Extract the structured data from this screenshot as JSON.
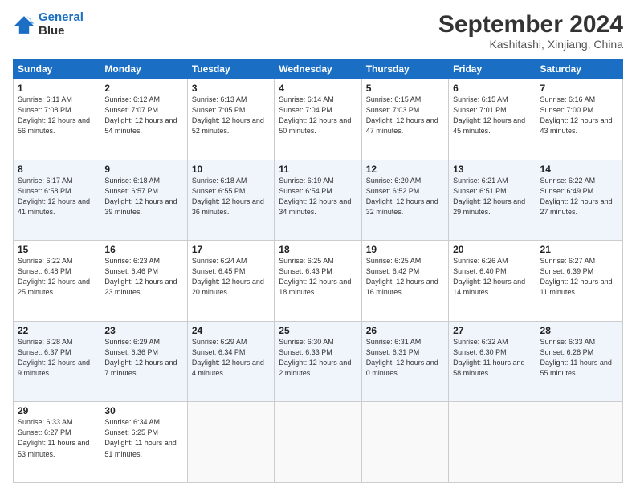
{
  "header": {
    "logo_line1": "General",
    "logo_line2": "Blue",
    "title": "September 2024",
    "subtitle": "Kashitashi, Xinjiang, China"
  },
  "calendar": {
    "days_of_week": [
      "Sunday",
      "Monday",
      "Tuesday",
      "Wednesday",
      "Thursday",
      "Friday",
      "Saturday"
    ],
    "weeks": [
      [
        {
          "day": "1",
          "sunrise": "6:11 AM",
          "sunset": "7:08 PM",
          "daylight": "12 hours and 56 minutes."
        },
        {
          "day": "2",
          "sunrise": "6:12 AM",
          "sunset": "7:07 PM",
          "daylight": "12 hours and 54 minutes."
        },
        {
          "day": "3",
          "sunrise": "6:13 AM",
          "sunset": "7:05 PM",
          "daylight": "12 hours and 52 minutes."
        },
        {
          "day": "4",
          "sunrise": "6:14 AM",
          "sunset": "7:04 PM",
          "daylight": "12 hours and 50 minutes."
        },
        {
          "day": "5",
          "sunrise": "6:15 AM",
          "sunset": "7:03 PM",
          "daylight": "12 hours and 47 minutes."
        },
        {
          "day": "6",
          "sunrise": "6:15 AM",
          "sunset": "7:01 PM",
          "daylight": "12 hours and 45 minutes."
        },
        {
          "day": "7",
          "sunrise": "6:16 AM",
          "sunset": "7:00 PM",
          "daylight": "12 hours and 43 minutes."
        }
      ],
      [
        {
          "day": "8",
          "sunrise": "6:17 AM",
          "sunset": "6:58 PM",
          "daylight": "12 hours and 41 minutes."
        },
        {
          "day": "9",
          "sunrise": "6:18 AM",
          "sunset": "6:57 PM",
          "daylight": "12 hours and 39 minutes."
        },
        {
          "day": "10",
          "sunrise": "6:18 AM",
          "sunset": "6:55 PM",
          "daylight": "12 hours and 36 minutes."
        },
        {
          "day": "11",
          "sunrise": "6:19 AM",
          "sunset": "6:54 PM",
          "daylight": "12 hours and 34 minutes."
        },
        {
          "day": "12",
          "sunrise": "6:20 AM",
          "sunset": "6:52 PM",
          "daylight": "12 hours and 32 minutes."
        },
        {
          "day": "13",
          "sunrise": "6:21 AM",
          "sunset": "6:51 PM",
          "daylight": "12 hours and 29 minutes."
        },
        {
          "day": "14",
          "sunrise": "6:22 AM",
          "sunset": "6:49 PM",
          "daylight": "12 hours and 27 minutes."
        }
      ],
      [
        {
          "day": "15",
          "sunrise": "6:22 AM",
          "sunset": "6:48 PM",
          "daylight": "12 hours and 25 minutes."
        },
        {
          "day": "16",
          "sunrise": "6:23 AM",
          "sunset": "6:46 PM",
          "daylight": "12 hours and 23 minutes."
        },
        {
          "day": "17",
          "sunrise": "6:24 AM",
          "sunset": "6:45 PM",
          "daylight": "12 hours and 20 minutes."
        },
        {
          "day": "18",
          "sunrise": "6:25 AM",
          "sunset": "6:43 PM",
          "daylight": "12 hours and 18 minutes."
        },
        {
          "day": "19",
          "sunrise": "6:25 AM",
          "sunset": "6:42 PM",
          "daylight": "12 hours and 16 minutes."
        },
        {
          "day": "20",
          "sunrise": "6:26 AM",
          "sunset": "6:40 PM",
          "daylight": "12 hours and 14 minutes."
        },
        {
          "day": "21",
          "sunrise": "6:27 AM",
          "sunset": "6:39 PM",
          "daylight": "12 hours and 11 minutes."
        }
      ],
      [
        {
          "day": "22",
          "sunrise": "6:28 AM",
          "sunset": "6:37 PM",
          "daylight": "12 hours and 9 minutes."
        },
        {
          "day": "23",
          "sunrise": "6:29 AM",
          "sunset": "6:36 PM",
          "daylight": "12 hours and 7 minutes."
        },
        {
          "day": "24",
          "sunrise": "6:29 AM",
          "sunset": "6:34 PM",
          "daylight": "12 hours and 4 minutes."
        },
        {
          "day": "25",
          "sunrise": "6:30 AM",
          "sunset": "6:33 PM",
          "daylight": "12 hours and 2 minutes."
        },
        {
          "day": "26",
          "sunrise": "6:31 AM",
          "sunset": "6:31 PM",
          "daylight": "12 hours and 0 minutes."
        },
        {
          "day": "27",
          "sunrise": "6:32 AM",
          "sunset": "6:30 PM",
          "daylight": "11 hours and 58 minutes."
        },
        {
          "day": "28",
          "sunrise": "6:33 AM",
          "sunset": "6:28 PM",
          "daylight": "11 hours and 55 minutes."
        }
      ],
      [
        {
          "day": "29",
          "sunrise": "6:33 AM",
          "sunset": "6:27 PM",
          "daylight": "11 hours and 53 minutes."
        },
        {
          "day": "30",
          "sunrise": "6:34 AM",
          "sunset": "6:25 PM",
          "daylight": "11 hours and 51 minutes."
        },
        {
          "day": "",
          "sunrise": "",
          "sunset": "",
          "daylight": ""
        },
        {
          "day": "",
          "sunrise": "",
          "sunset": "",
          "daylight": ""
        },
        {
          "day": "",
          "sunrise": "",
          "sunset": "",
          "daylight": ""
        },
        {
          "day": "",
          "sunrise": "",
          "sunset": "",
          "daylight": ""
        },
        {
          "day": "",
          "sunrise": "",
          "sunset": "",
          "daylight": ""
        }
      ]
    ]
  }
}
